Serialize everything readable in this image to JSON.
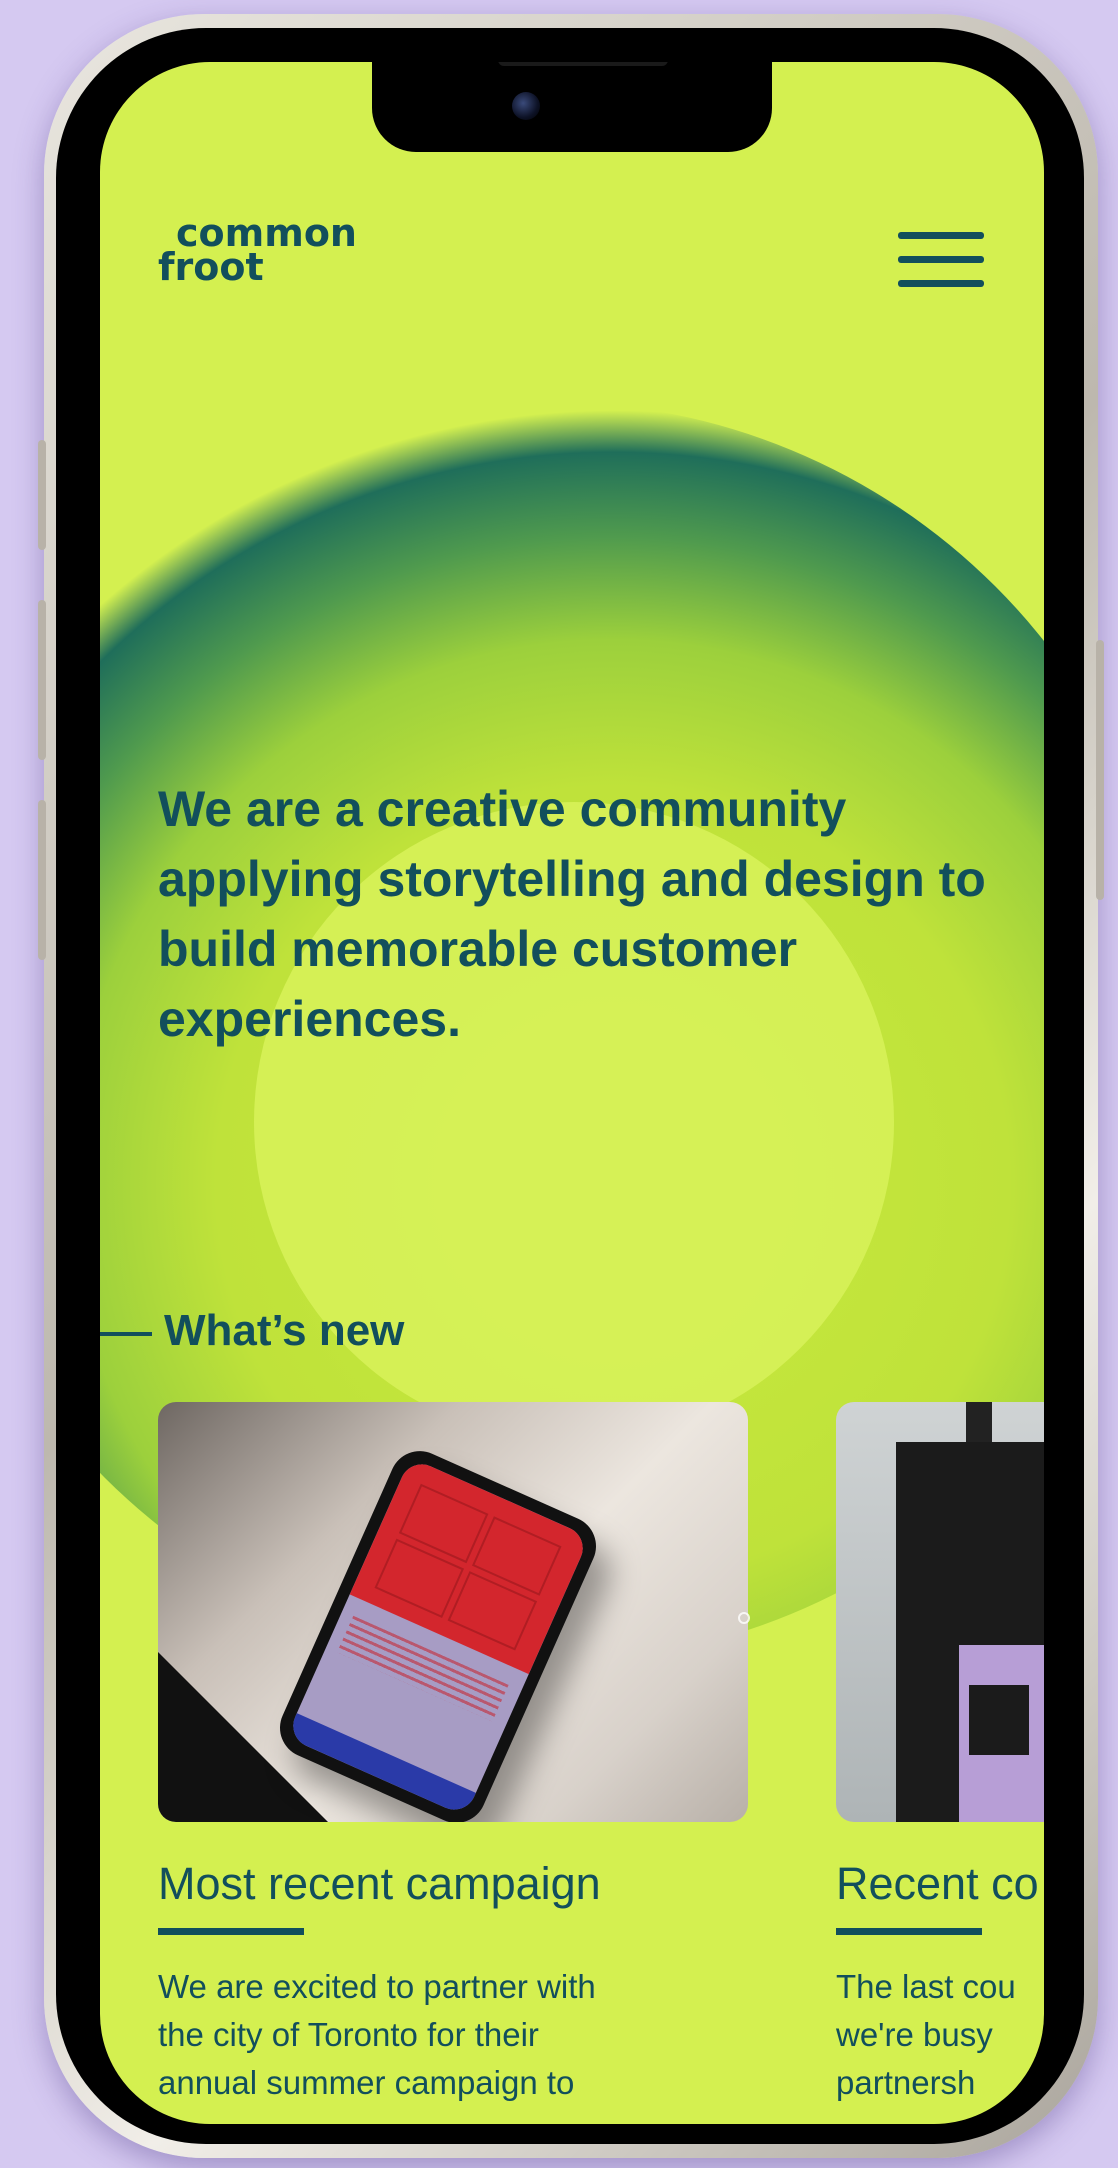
{
  "app": {
    "logo_line1": "common",
    "logo_line2": "froot"
  },
  "hero": {
    "text": "We are a creative community applying storytelling and design to build memorable customer experiences."
  },
  "whats_new": {
    "title": "What’s new"
  },
  "cards": [
    {
      "title": "Most recent campaign",
      "body": [
        "We are excited to partner with",
        "the city of Toronto for their",
        "annual summer campaign to"
      ]
    },
    {
      "title": "Recent co",
      "body": [
        "The last cou",
        "we're busy ",
        "partnersh"
      ]
    }
  ],
  "colors": {
    "brand": "#124f5c",
    "background": "#d4f050",
    "page": "#d5c9f1"
  },
  "icons": [
    "hamburger-menu-icon"
  ]
}
